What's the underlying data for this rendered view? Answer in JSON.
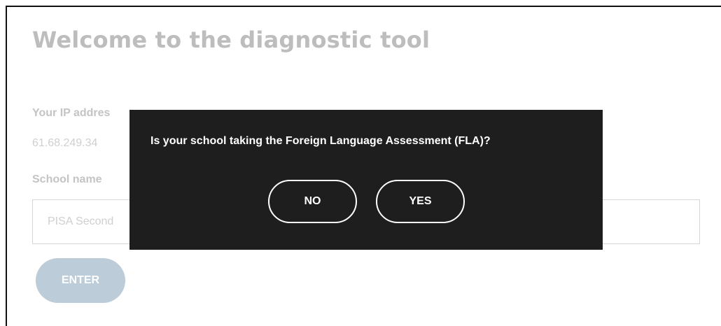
{
  "page": {
    "title": "Welcome to the diagnostic tool",
    "ip_label": "Your IP addres",
    "ip_value": "61.68.249.34",
    "school_label": "School name",
    "school_input_value": "PISA Second",
    "enter_label": "ENTER"
  },
  "modal": {
    "question": "Is your school taking the Foreign Language Assessment (FLA)?",
    "no_label": "NO",
    "yes_label": "YES"
  },
  "colors": {
    "modal_background": "#1e1e1e",
    "enter_button": "#bcccd8",
    "muted_text": "#bdbdbd"
  }
}
